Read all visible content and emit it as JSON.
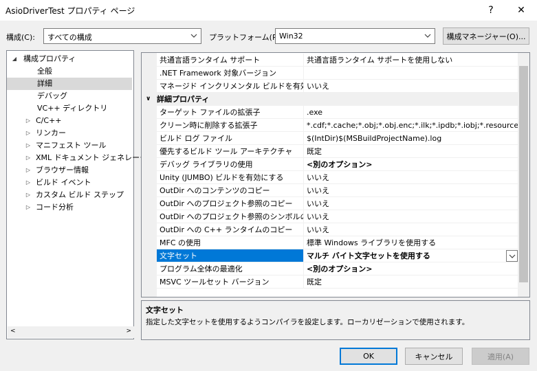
{
  "window": {
    "title": "AsioDriverTest プロパティ ページ",
    "help_glyph": "?",
    "close_glyph": "✕"
  },
  "toolbar": {
    "config_label": "構成(C):",
    "config_value": "すべての構成",
    "platform_label": "プラットフォーム(P):",
    "platform_value": "Win32",
    "config_manager_label": "構成マネージャー(O)..."
  },
  "tree": {
    "root": "構成プロパティ",
    "items": [
      {
        "label": "全般",
        "expandable": false
      },
      {
        "label": "詳細",
        "expandable": false,
        "selected": true
      },
      {
        "label": "デバッグ",
        "expandable": false
      },
      {
        "label": "VC++ ディレクトリ",
        "expandable": false
      },
      {
        "label": "C/C++",
        "expandable": true
      },
      {
        "label": "リンカー",
        "expandable": true
      },
      {
        "label": "マニフェスト ツール",
        "expandable": true
      },
      {
        "label": "XML ドキュメント ジェネレーター",
        "expandable": true
      },
      {
        "label": "ブラウザー情報",
        "expandable": true
      },
      {
        "label": "ビルド イベント",
        "expandable": true
      },
      {
        "label": "カスタム ビルド ステップ",
        "expandable": true
      },
      {
        "label": "コード分析",
        "expandable": true
      }
    ]
  },
  "grid": {
    "rows_before": [
      {
        "name": "共通言語ランタイム サポート",
        "value": "共通言語ランタイム サポートを使用しない"
      },
      {
        "name": ".NET Framework 対象バージョン",
        "value": ""
      },
      {
        "name": "マネージド インクリメンタル ビルドを有効にする",
        "value": "いいえ"
      }
    ],
    "category": "詳細プロパティ",
    "rows": [
      {
        "name": "ターゲット ファイルの拡張子",
        "value": ".exe"
      },
      {
        "name": "クリーン時に削除する拡張子",
        "value": "*.cdf;*.cache;*.obj;*.obj.enc;*.ilk;*.ipdb;*.iobj;*.resources;*.tlb;*.tli;*.tlh"
      },
      {
        "name": "ビルド ログ ファイル",
        "value": "$(IntDir)$(MSBuildProjectName).log"
      },
      {
        "name": "優先するビルド ツール アーキテクチャ",
        "value": "既定"
      },
      {
        "name": "デバッグ ライブラリの使用",
        "value": "<別のオプション>",
        "bold": true
      },
      {
        "name": "Unity (JUMBO) ビルドを有効にする",
        "value": "いいえ"
      },
      {
        "name": "OutDir へのコンテンツのコピー",
        "value": "いいえ"
      },
      {
        "name": "OutDir へのプロジェクト参照のコピー",
        "value": "いいえ"
      },
      {
        "name": "OutDir へのプロジェクト参照のシンボルのコピー",
        "value": "いいえ"
      },
      {
        "name": "OutDir への C++ ランタイムのコピー",
        "value": "いいえ"
      },
      {
        "name": "MFC の使用",
        "value": "標準 Windows ライブラリを使用する"
      },
      {
        "name": "文字セット",
        "value": "マルチ バイト文字セットを使用する",
        "selected": true
      },
      {
        "name": "プログラム全体の最適化",
        "value": "<別のオプション>",
        "bold": true
      },
      {
        "name": "MSVC ツールセット バージョン",
        "value": "既定"
      }
    ]
  },
  "description": {
    "title": "文字セット",
    "text": "指定した文字セットを使用するようコンパイラを設定します。ローカリゼーションで使用されます。"
  },
  "buttons": {
    "ok": "OK",
    "cancel": "キャンセル",
    "apply": "適用(A)"
  },
  "colors": {
    "accent": "#0078d7",
    "tree_selection": "#d9d9d9"
  }
}
